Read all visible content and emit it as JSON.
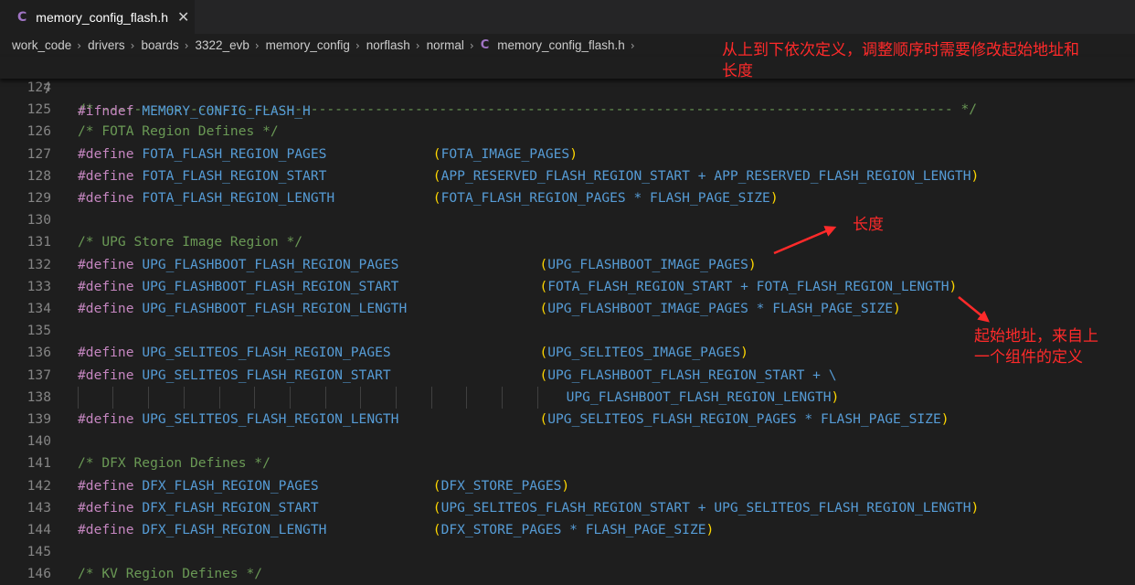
{
  "tab": {
    "icon": "c-language-icon",
    "icon_label": "C",
    "title": "memory_config_flash.h",
    "close_glyph": "✕"
  },
  "breadcrumb": [
    "work_code",
    "drivers",
    "boards",
    "3322_evb",
    "memory_config",
    "norflash",
    "normal"
  ],
  "breadcrumb_file": {
    "icon_label": "C",
    "name": "memory_config_flash.h"
  },
  "colors": {
    "keyword": "#c586c0",
    "macro": "#569cd6",
    "comment": "#6a9955",
    "bracket": "#ffd700",
    "annotation": "#ff2a2a"
  },
  "sticky_line": {
    "num": "7",
    "keyword": "#ifndef",
    "name": "MEMORY_CONFIG_FLASH_H"
  },
  "lines": [
    {
      "num": "124",
      "kind": "blank"
    },
    {
      "num": "125",
      "kind": "comment",
      "text": "/* ---------------------------------------------------------------------------------------------------------- */"
    },
    {
      "num": "126",
      "kind": "comment",
      "text": "/* FOTA Region Defines */"
    },
    {
      "num": "127",
      "kind": "define",
      "name": "FOTA_FLASH_REGION_PAGES",
      "col": 40,
      "open": "(",
      "value": "FOTA_IMAGE_PAGES",
      "close": ")"
    },
    {
      "num": "128",
      "kind": "define",
      "name": "FOTA_FLASH_REGION_START",
      "col": 40,
      "open": "(",
      "value": "APP_RESERVED_FLASH_REGION_START + APP_RESERVED_FLASH_REGION_LENGTH",
      "close": ")"
    },
    {
      "num": "129",
      "kind": "define",
      "name": "FOTA_FLASH_REGION_LENGTH",
      "col": 40,
      "open": "(",
      "value": "FOTA_FLASH_REGION_PAGES * FLASH_PAGE_SIZE",
      "close": ")"
    },
    {
      "num": "130",
      "kind": "blank"
    },
    {
      "num": "131",
      "kind": "comment",
      "text": "/* UPG Store Image Region */"
    },
    {
      "num": "132",
      "kind": "define",
      "name": "UPG_FLASHBOOT_FLASH_REGION_PAGES",
      "col": 52,
      "open": "(",
      "value": "UPG_FLASHBOOT_IMAGE_PAGES",
      "close": ")"
    },
    {
      "num": "133",
      "kind": "define",
      "name": "UPG_FLASHBOOT_FLASH_REGION_START",
      "col": 52,
      "open": "(",
      "value": "FOTA_FLASH_REGION_START + FOTA_FLASH_REGION_LENGTH",
      "close": ")"
    },
    {
      "num": "134",
      "kind": "define",
      "name": "UPG_FLASHBOOT_FLASH_REGION_LENGTH",
      "col": 52,
      "open": "(",
      "value": "UPG_FLASHBOOT_IMAGE_PAGES * FLASH_PAGE_SIZE",
      "close": ")"
    },
    {
      "num": "135",
      "kind": "blank"
    },
    {
      "num": "136",
      "kind": "define",
      "name": "UPG_SELITEOS_FLASH_REGION_PAGES",
      "col": 52,
      "open": "(",
      "value": "UPG_SELITEOS_IMAGE_PAGES",
      "close": ")"
    },
    {
      "num": "137",
      "kind": "define",
      "name": "UPG_SELITEOS_FLASH_REGION_START",
      "col": 52,
      "open": "(",
      "value": "UPG_FLASHBOOT_FLASH_REGION_START + \\",
      "close": ""
    },
    {
      "num": "138",
      "kind": "continuation",
      "col": 55,
      "open": "",
      "value": "UPG_FLASHBOOT_FLASH_REGION_LENGTH",
      "close": ")"
    },
    {
      "num": "139",
      "kind": "define",
      "name": "UPG_SELITEOS_FLASH_REGION_LENGTH",
      "col": 52,
      "open": "(",
      "value": "UPG_SELITEOS_FLASH_REGION_PAGES * FLASH_PAGE_SIZE",
      "close": ")"
    },
    {
      "num": "140",
      "kind": "blank"
    },
    {
      "num": "141",
      "kind": "comment",
      "text": "/* DFX Region Defines */"
    },
    {
      "num": "142",
      "kind": "define",
      "name": "DFX_FLASH_REGION_PAGES",
      "col": 40,
      "open": "(",
      "value": "DFX_STORE_PAGES",
      "close": ")"
    },
    {
      "num": "143",
      "kind": "define",
      "name": "DFX_FLASH_REGION_START",
      "col": 40,
      "open": "(",
      "value": "UPG_SELITEOS_FLASH_REGION_START + UPG_SELITEOS_FLASH_REGION_LENGTH",
      "close": ")"
    },
    {
      "num": "144",
      "kind": "define",
      "name": "DFX_FLASH_REGION_LENGTH",
      "col": 40,
      "open": "(",
      "value": "DFX_STORE_PAGES * FLASH_PAGE_SIZE",
      "close": ")"
    },
    {
      "num": "145",
      "kind": "blank"
    },
    {
      "num": "146",
      "kind": "comment",
      "text": "/* KV Region Defines */"
    }
  ],
  "define_keyword": "#define",
  "annotations": {
    "top_note_line1": "从上到下依次定义，调整顺序时需要修改起始地址和",
    "top_note_line2": "长度",
    "length_note": "长度",
    "start_note_line1": "起始地址，来自上",
    "start_note_line2": "一个组件的定义"
  }
}
